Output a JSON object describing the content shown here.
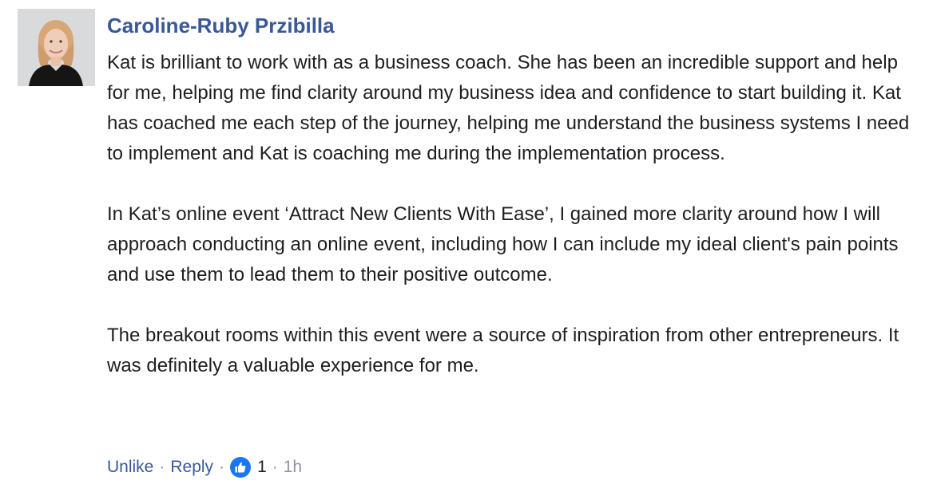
{
  "comment": {
    "author": "Caroline-Ruby Przibilla",
    "paragraphs": [
      "Kat is brilliant to work with as a business coach. She has been an incredible support and help for me, helping me find clarity around my business idea and confidence to start building it. Kat has coached me each step of the journey, helping me understand the business systems I need to implement and Kat is coaching me during the implementation process.",
      "In Kat’s online event ‘Attract New Clients With Ease’, I gained more clarity around how I will approach conducting an online event, including how I can include my ideal client's pain points and use them to lead them to their positive outcome.",
      "The breakout rooms within this event were a source of inspiration from other entrepreneurs. It was definitely a valuable experience for me."
    ],
    "actions": {
      "unlike": "Unlike",
      "reply": "Reply",
      "separator": "·",
      "like_count": "1",
      "timestamp": "1h"
    },
    "icons": {
      "avatar": "profile-photo",
      "reaction": "thumbs-up-icon"
    },
    "colors": {
      "link": "#385898",
      "text": "#1c1e21",
      "meta": "#90949c",
      "like_badge": "#1877f2"
    }
  }
}
